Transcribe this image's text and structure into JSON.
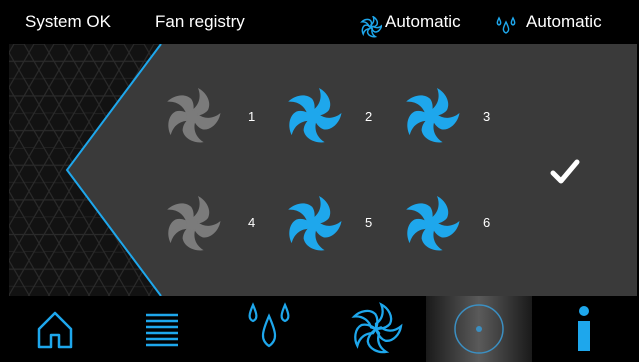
{
  "status": {
    "system_status": "System OK",
    "screen_title": "Fan registry",
    "fan_mode_icon": "fan-icon",
    "fan_mode": "Automatic",
    "water_mode_icon": "water-drops-icon",
    "water_mode": "Automatic"
  },
  "colors": {
    "accent": "#1ea7ec",
    "fan_active": "#1ea7ec",
    "fan_inactive": "#7b7b7b",
    "panel_bg": "#3a3a3a",
    "bar_bg": "#000000"
  },
  "fans": [
    {
      "number": "1",
      "active": false
    },
    {
      "number": "2",
      "active": true
    },
    {
      "number": "3",
      "active": true
    },
    {
      "number": "4",
      "active": false
    },
    {
      "number": "5",
      "active": true
    },
    {
      "number": "6",
      "active": true
    }
  ],
  "confirm_icon": "checkmark-icon",
  "nav": [
    {
      "icon": "home-icon",
      "active": false
    },
    {
      "icon": "list-icon",
      "active": false
    },
    {
      "icon": "water-drops-icon",
      "active": false
    },
    {
      "icon": "fan-icon",
      "active": false
    },
    {
      "icon": "circle-dot-icon",
      "active": true
    },
    {
      "icon": "info-icon",
      "active": false
    }
  ]
}
